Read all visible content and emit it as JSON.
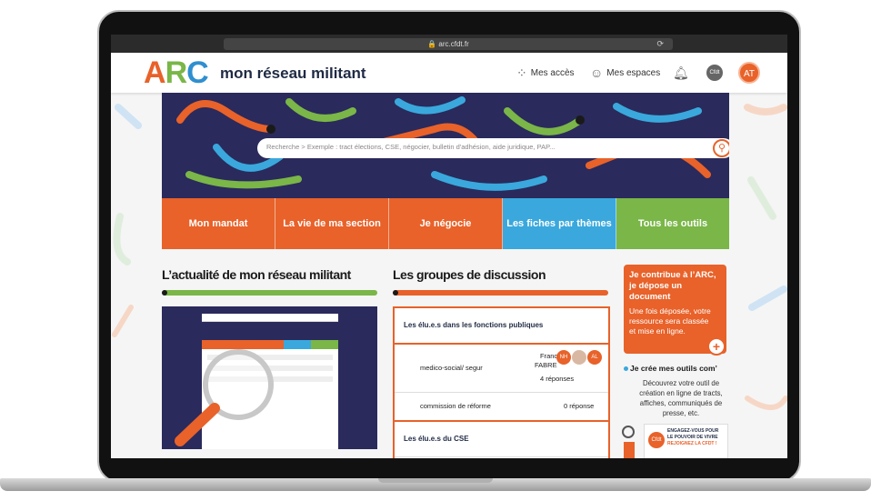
{
  "browser": {
    "url": "arc.cfdt.fr"
  },
  "header": {
    "logo_letters": [
      "A",
      "R",
      "C"
    ],
    "logo_text": "mon réseau militant",
    "mes_acces": "Mes accès",
    "mes_espaces": "Mes espaces",
    "cfdt_badge": "Cfdt",
    "avatar_initials": "AT"
  },
  "search": {
    "placeholder": "Recherche > Exemple : tract élections, CSE, négocier, bulletin d'adhésion, aide juridique, PAP..."
  },
  "nav": [
    {
      "label": "Mon mandat",
      "color": "#e8622a"
    },
    {
      "label": "La vie de ma section",
      "color": "#e8622a"
    },
    {
      "label": "Je négocie",
      "color": "#e8622a"
    },
    {
      "label": "Les fiches par thèmes",
      "color": "#3aa8dc"
    },
    {
      "label": "Tous les outils",
      "color": "#7ab648"
    }
  ],
  "news": {
    "title": "L’actualité de mon réseau militant"
  },
  "groups": {
    "title": "Les groupes de discussion",
    "section1": "Les élu.e.s dans les fonctions publiques",
    "rows": [
      {
        "topic": "medico-social/ segur",
        "author": "Franc",
        "author2": "FABRE",
        "replies": "4 réponses",
        "avatars": [
          "NH",
          "",
          "AL"
        ]
      },
      {
        "topic": "commission de réforme",
        "replies": "0 réponse"
      }
    ],
    "section2": "Les élu.e.s du CSE"
  },
  "contrib": {
    "title1": "Je contribue à l’ARC,",
    "title2": "je dépose un document",
    "text": "Une fois déposée, votre ressource sera classée et mise en ligne."
  },
  "tools": {
    "title": "Je crée mes outils com’",
    "text": "Découvrez votre outil de création en ligne de tracts, affiches, communiqués de presse, etc."
  },
  "ad": {
    "brand": "Cfdt",
    "line1": "ENGAGEZ-VOUS POUR",
    "line2": "LE POUVOIR DE VIVRE",
    "line3": "REJOIGNEZ LA CFDT !"
  }
}
